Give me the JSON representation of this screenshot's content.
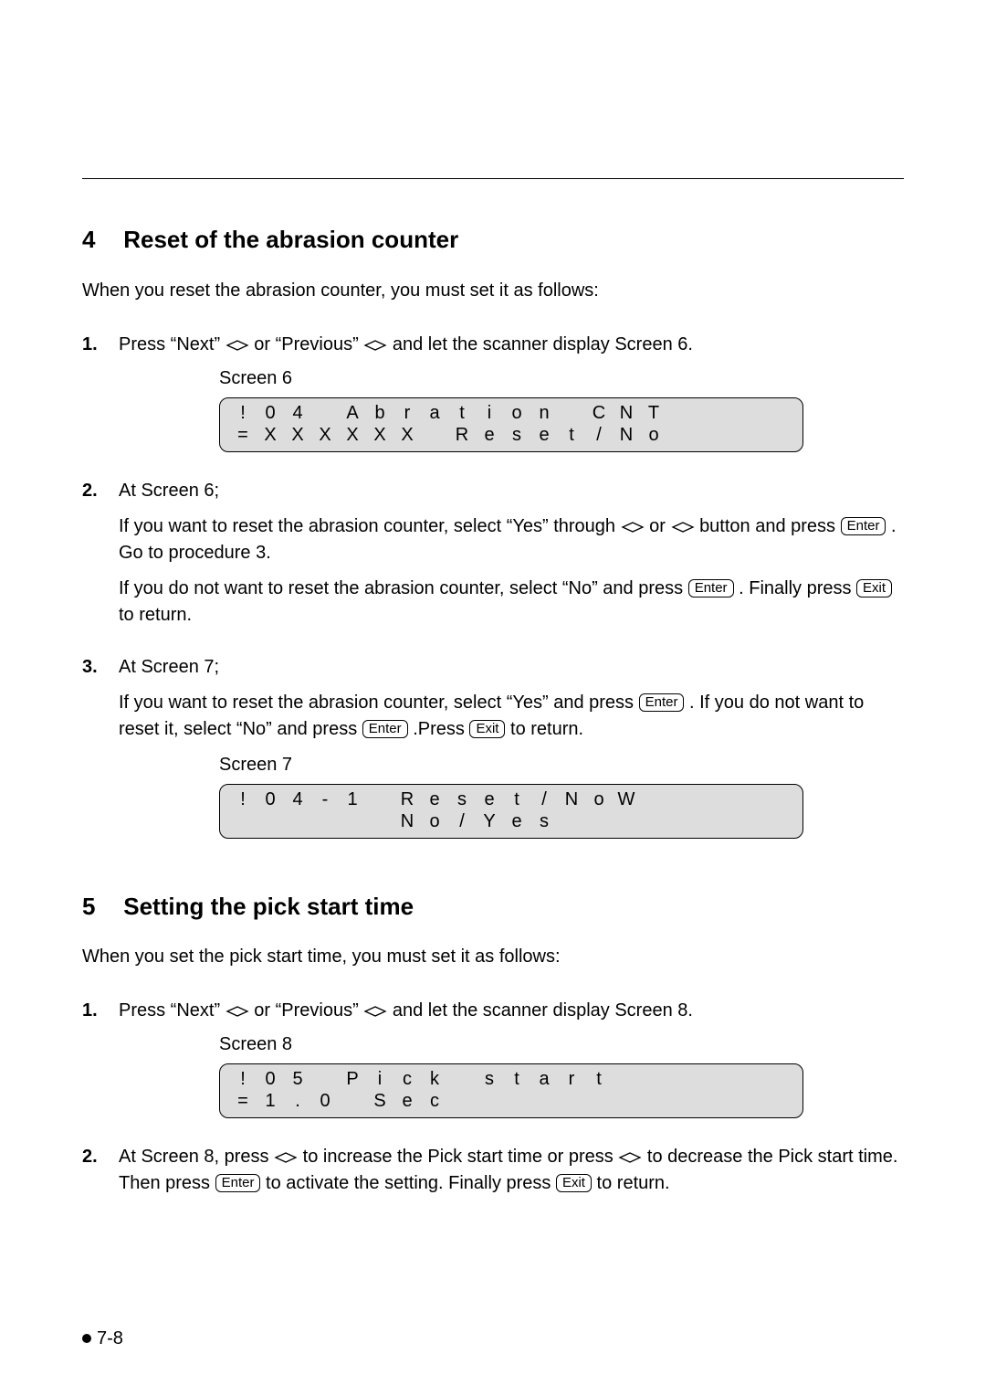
{
  "section4": {
    "number": "4",
    "title": "Reset of the abrasion counter",
    "intro": "When you reset the abrasion counter, you must set it as follows:",
    "step1": {
      "marker": "1.",
      "t1": "Press “Next” ",
      "t2": " or “Previous” ",
      "t3": " and let the scanner display Screen 6.",
      "screen_label": "Screen 6",
      "lcd": {
        "row1": [
          "!",
          "0",
          "4",
          "",
          "A",
          "b",
          "r",
          "a",
          "t",
          "i",
          "o",
          "n",
          "",
          "C",
          "N",
          "T"
        ],
        "row2": [
          "=",
          "X",
          "X",
          "X",
          "X",
          "X",
          "X",
          "",
          "R",
          "e",
          "s",
          "e",
          "t",
          "/",
          "N",
          "o"
        ]
      }
    },
    "step2": {
      "marker": "2.",
      "head": "At Screen 6;",
      "p1a": "If you want to reset the abrasion counter, select “Yes” through ",
      "p1b": " or ",
      "p1c": " button and press ",
      "p1d": " . Go to procedure 3.",
      "p2a": "If you do not want to reset the abrasion counter, select “No” and press ",
      "p2b": " . Finally press ",
      "p2c": " to return."
    },
    "step3": {
      "marker": "3.",
      "head": "At Screen 7;",
      "p1a": "If you want to reset the abrasion counter, select “Yes” and press ",
      "p1b": " . If you do not want to reset it, select “No” and press ",
      "p1c": " .Press ",
      "p1d": " to return.",
      "screen_label": "Screen 7",
      "lcd": {
        "row1": [
          "!",
          "0",
          "4",
          "-",
          "1",
          "",
          "R",
          "e",
          "s",
          "e",
          "t",
          "/",
          "N",
          "o",
          "W",
          ""
        ],
        "row2": [
          "",
          "",
          "",
          "",
          "",
          "",
          "N",
          "o",
          "/",
          "Y",
          "e",
          "s",
          "",
          "",
          "",
          ""
        ]
      }
    }
  },
  "section5": {
    "number": "5",
    "title": "Setting the pick start time",
    "intro": "When you set the pick start time, you must set it as follows:",
    "step1": {
      "marker": "1.",
      "t1": "Press “Next” ",
      "t2": " or “Previous” ",
      "t3": " and let the scanner display Screen 8.",
      "screen_label": "Screen 8",
      "lcd": {
        "row1": [
          "!",
          "0",
          "5",
          "",
          "P",
          "i",
          "c",
          "k",
          "",
          "s",
          "t",
          "a",
          "r",
          "t",
          "",
          ""
        ],
        "row2": [
          "=",
          "1",
          ".",
          "0",
          "",
          "S",
          "e",
          "c",
          "",
          "",
          "",
          "",
          "",
          "",
          "",
          ""
        ]
      }
    },
    "step2": {
      "marker": "2.",
      "t1": "At Screen 8, press ",
      "t2": " to increase the Pick start time or press ",
      "t3": " to decrease the Pick start time. Then press ",
      "t4": " to activate the setting. Finally press ",
      "t5": " to return."
    }
  },
  "keys": {
    "enter": "Enter",
    "exit": "Exit"
  },
  "footer": "7-8"
}
